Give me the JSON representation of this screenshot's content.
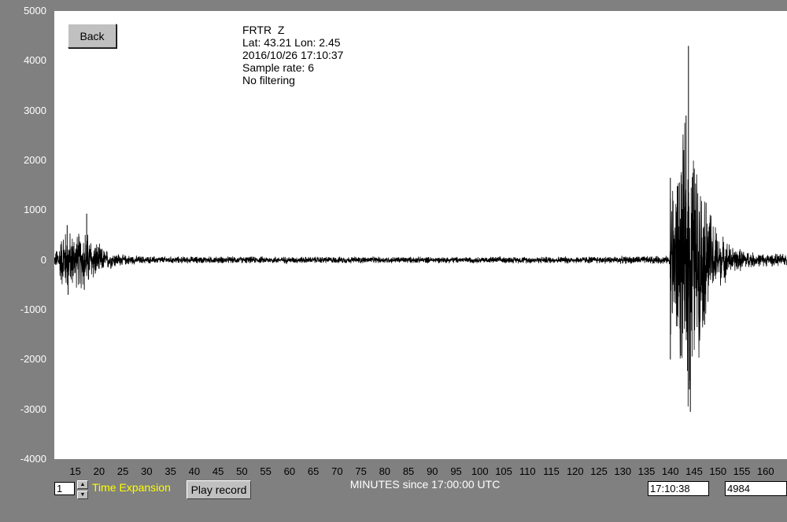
{
  "toolbar": {
    "back_label": "Back",
    "play_label": "Play record"
  },
  "station_info": {
    "line1": "FRTR  Z",
    "line2": "Lat: 43.21 Lon: 2.45",
    "line3": "2016/10/26 17:10:37",
    "line4": "Sample rate: 6",
    "line5": "No filtering"
  },
  "controls": {
    "expansion_value": "1",
    "expansion_label": "Time Expansion"
  },
  "readouts": {
    "time": "17:10:38",
    "count": "4984"
  },
  "colors": {
    "background": "#808080",
    "plot_bg": "#ffffff",
    "trace": "#000000",
    "label_highlight": "#ffff00"
  },
  "chart_data": {
    "type": "line",
    "xlabel": "MINUTES since 17:00:00 UTC",
    "ylabel": "",
    "xlim": [
      10.6,
      164.5
    ],
    "ylim": [
      -4000,
      5000
    ],
    "xticks": [
      15,
      20,
      25,
      30,
      35,
      40,
      45,
      50,
      55,
      60,
      65,
      70,
      75,
      80,
      85,
      90,
      95,
      100,
      105,
      110,
      115,
      120,
      125,
      130,
      135,
      140,
      145,
      150,
      155,
      160
    ],
    "yticks": [
      5000,
      4000,
      3000,
      2000,
      1000,
      0,
      -1000,
      -2000,
      -3000,
      -4000
    ],
    "grid": false,
    "series": [
      {
        "envelope": [
          {
            "x": 10.6,
            "amp": 100
          },
          {
            "x": 12.5,
            "amp": 700
          },
          {
            "x": 15,
            "amp": 600
          },
          {
            "x": 17,
            "amp": 700
          },
          {
            "x": 19,
            "amp": 450
          },
          {
            "x": 21,
            "amp": 250
          },
          {
            "x": 25,
            "amp": 120
          },
          {
            "x": 30,
            "amp": 80
          },
          {
            "x": 100,
            "amp": 70
          },
          {
            "x": 139.8,
            "amp": 90
          },
          {
            "x": 140,
            "amp": 1800
          },
          {
            "x": 141,
            "amp": 2000
          },
          {
            "x": 142.5,
            "amp": 2600
          },
          {
            "x": 143.8,
            "amp": 3300
          },
          {
            "x": 145,
            "amp": 2500
          },
          {
            "x": 147,
            "amp": 1500
          },
          {
            "x": 150,
            "amp": 650
          },
          {
            "x": 153,
            "amp": 300
          },
          {
            "x": 158,
            "amp": 150
          },
          {
            "x": 164.5,
            "amp": 130
          }
        ],
        "peaks": [
          {
            "x": 13.3,
            "y": 700
          },
          {
            "x": 13.5,
            "y": -700
          },
          {
            "x": 17.4,
            "y": 930
          },
          {
            "x": 16.9,
            "y": -600
          },
          {
            "x": 140.0,
            "y": 1650
          },
          {
            "x": 140.0,
            "y": -2000
          },
          {
            "x": 143.8,
            "y": 4300
          },
          {
            "x": 144.2,
            "y": -3050
          },
          {
            "x": 143.3,
            "y": 2900
          },
          {
            "x": 144.0,
            "y": -2600
          },
          {
            "x": 147.5,
            "y": 1150
          },
          {
            "x": 147.2,
            "y": -1300
          }
        ]
      }
    ]
  }
}
